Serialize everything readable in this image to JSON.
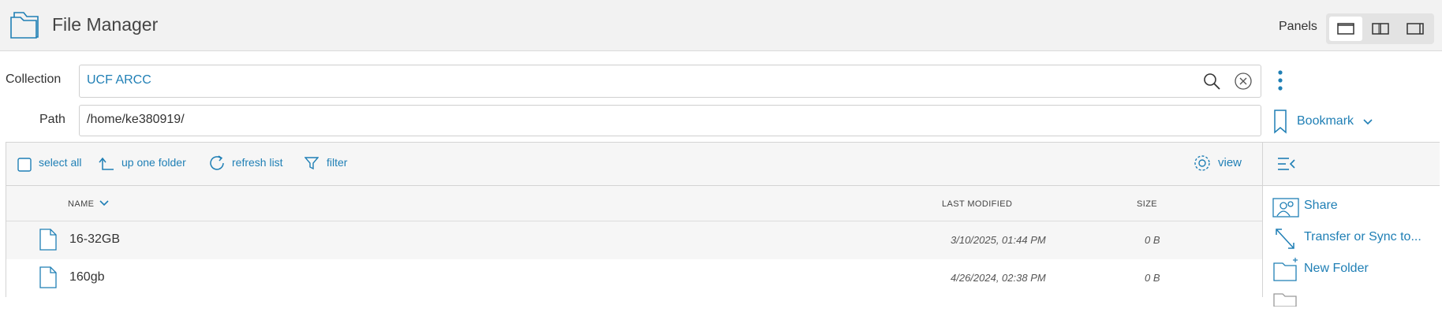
{
  "app": {
    "title": "File Manager"
  },
  "panels": {
    "label": "Panels",
    "options": [
      "single-panel",
      "dual-panel",
      "panel-right"
    ],
    "active": 0
  },
  "collection": {
    "label": "Collection",
    "value": "UCF ARCC"
  },
  "path": {
    "label": "Path",
    "value": "/home/ke380919/"
  },
  "bookmark": {
    "label": "Bookmark"
  },
  "toolbar": {
    "select_all": "select all",
    "up_one_folder": "up one folder",
    "refresh_list": "refresh list",
    "filter": "filter",
    "view": "view"
  },
  "table": {
    "headers": {
      "name": "NAME",
      "last_modified": "LAST MODIFIED",
      "size": "SIZE"
    },
    "rows": [
      {
        "name": "16-32GB",
        "last_modified": "3/10/2025, 01:44 PM",
        "size": "0 B"
      },
      {
        "name": "160gb",
        "last_modified": "4/26/2024, 02:38 PM",
        "size": "0 B"
      }
    ]
  },
  "actions": {
    "share": "Share",
    "transfer": "Transfer or Sync to...",
    "new_folder": "New Folder"
  },
  "colors": {
    "accent": "#1f7fb5",
    "topbar": "#f2f2f2",
    "row_alt": "#f6f6f6"
  }
}
